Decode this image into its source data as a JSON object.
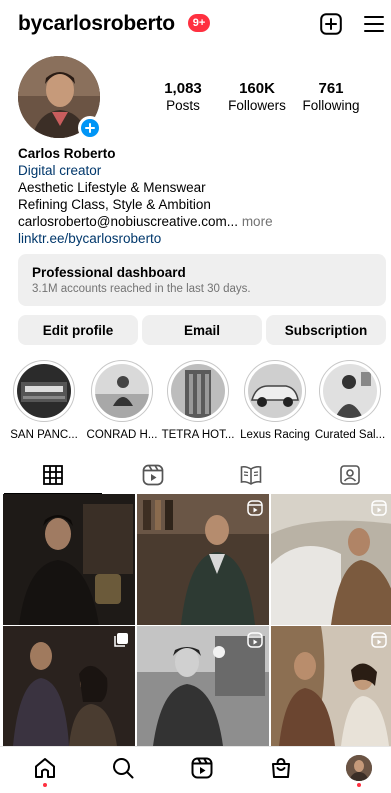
{
  "header": {
    "username": "bycarlosroberto",
    "notification_count": "9+",
    "create_icon": "plus-square-icon",
    "menu_icon": "hamburger-menu-icon"
  },
  "profile": {
    "stats": [
      {
        "value": "1,083",
        "label": "Posts"
      },
      {
        "value": "160K",
        "label": "Followers"
      },
      {
        "value": "761",
        "label": "Following"
      }
    ],
    "name": "Carlos Roberto",
    "category": "Digital creator",
    "bio_lines": [
      "Aesthetic Lifestyle & Menswear",
      "Refining Class, Style & Ambition"
    ],
    "email_line": "carlosroberto@nobiuscreative.com...",
    "more_label": " more",
    "link": "linktr.ee/bycarlosroberto"
  },
  "dashboard": {
    "title": "Professional dashboard",
    "subtitle": "3.1M accounts reached in the last 30 days."
  },
  "actions": [
    "Edit profile",
    "Email",
    "Subscription"
  ],
  "highlights": [
    {
      "label": "SAN PANC..."
    },
    {
      "label": "CONRAD H..."
    },
    {
      "label": "TETRA HOT..."
    },
    {
      "label": "Lexus Racing"
    },
    {
      "label": "Curated Sal..."
    }
  ],
  "tabs": [
    {
      "icon": "grid-icon",
      "active": true
    },
    {
      "icon": "reels-icon",
      "active": false
    },
    {
      "icon": "guide-icon",
      "active": false
    },
    {
      "icon": "tagged-icon",
      "active": false
    }
  ],
  "posts": [
    {
      "badge": "none"
    },
    {
      "badge": "reel-icon"
    },
    {
      "badge": "reel-icon"
    },
    {
      "badge": "carousel-icon"
    },
    {
      "badge": "reel-icon"
    },
    {
      "badge": "reel-icon"
    }
  ],
  "bottom_nav": [
    {
      "icon": "home-icon",
      "notification_dot": true
    },
    {
      "icon": "search-icon",
      "notification_dot": false
    },
    {
      "icon": "reels-icon",
      "notification_dot": false
    },
    {
      "icon": "shop-icon",
      "notification_dot": false
    },
    {
      "icon": "profile-avatar-icon",
      "notification_dot": true
    }
  ],
  "colors": {
    "badge_red": "#ff3040",
    "link_blue": "#00376b",
    "accent_blue": "#0095f6",
    "button_gray": "#efefef"
  }
}
